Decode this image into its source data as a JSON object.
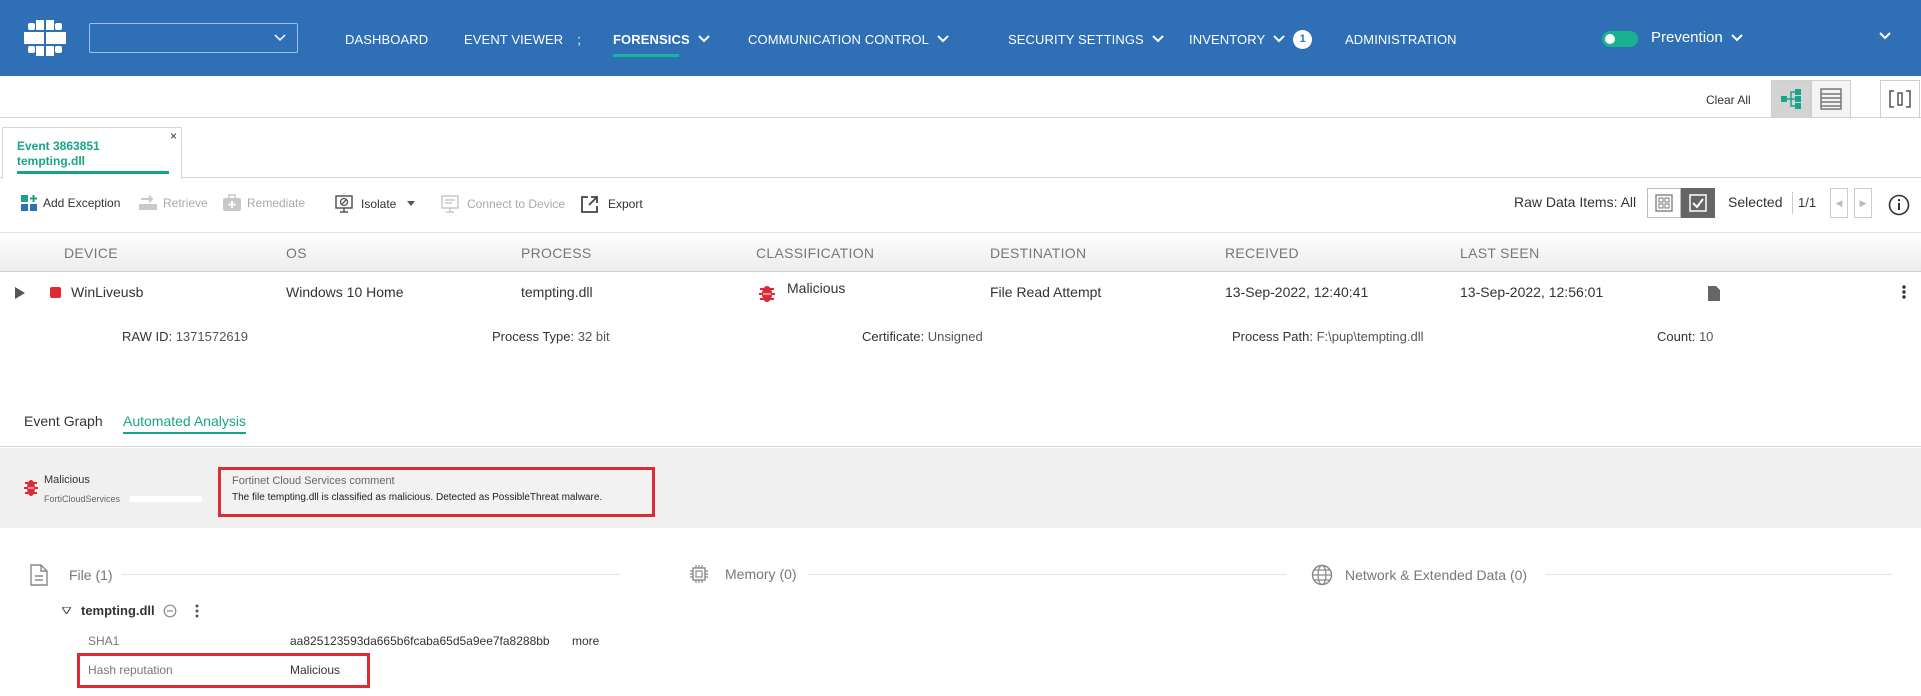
{
  "header": {
    "tenant_value": "",
    "nav": [
      {
        "label": "DASHBOARD"
      },
      {
        "label": "EVENT VIEWER",
        "suffix": ";"
      },
      {
        "label": "FORENSICS"
      },
      {
        "label": "COMMUNICATION CONTROL"
      },
      {
        "label": "SECURITY SETTINGS"
      },
      {
        "label": "INVENTORY",
        "badge": "1"
      },
      {
        "label": "ADMINISTRATION"
      }
    ],
    "active_nav": "FORENSICS",
    "mode_label": "Prevention",
    "mode_enabled": true,
    "colors": {
      "bar": "#2f6fb6",
      "accent": "#17b79a",
      "alert": "#dc2b35"
    }
  },
  "subbar": {
    "clear_all": "Clear All"
  },
  "event_tab": {
    "line1": "Event 3863851",
    "line2": "tempting.dll",
    "close": "×"
  },
  "actions": {
    "add_exception": "Add Exception",
    "retrieve": "Retrieve",
    "remediate": "Remediate",
    "isolate": "Isolate",
    "connect": "Connect to Device",
    "export": "Export",
    "raw_data": "Raw Data Items: All",
    "selected": "Selected",
    "pager": "1/1"
  },
  "table": {
    "columns": [
      "DEVICE",
      "OS",
      "PROCESS",
      "CLASSIFICATION",
      "DESTINATION",
      "RECEIVED",
      "LAST SEEN"
    ],
    "row": {
      "device": "WinLiveusb",
      "os": "Windows 10 Home",
      "process": "tempting.dll",
      "classification": "Malicious",
      "destination": "File Read Attempt",
      "received": "13-Sep-2022, 12:40:41",
      "last_seen": "13-Sep-2022, 12:56:01"
    },
    "details": {
      "raw_id_label": "RAW ID:",
      "raw_id": "1371572619",
      "process_type_label": "Process Type:",
      "process_type": "32 bit",
      "certificate_label": "Certificate:",
      "certificate": "Unsigned",
      "process_path_label": "Process Path:",
      "process_path": "F:\\pup\\tempting.dll",
      "count_label": "Count:",
      "count": "10"
    }
  },
  "analysis": {
    "tabs": [
      "Event Graph",
      "Automated Analysis"
    ],
    "active_tab": "Automated Analysis",
    "verdict": "Malicious",
    "verdict_source": "FortiCloudServices",
    "comment_title": "Fortinet Cloud Services comment",
    "comment_text": "The file tempting.dll is classified as malicious. Detected as PossibleThreat malware."
  },
  "sections": {
    "file": "File (1)",
    "memory": "Memory (0)",
    "network": "Network & Extended Data (0)"
  },
  "file_entry": {
    "name": "tempting.dll",
    "sha1_label": "SHA1",
    "sha1": "aa825123593da665b6fcaba65d5a9ee7fa8288bb",
    "more": "more",
    "hash_rep_label": "Hash reputation",
    "hash_rep": "Malicious"
  }
}
